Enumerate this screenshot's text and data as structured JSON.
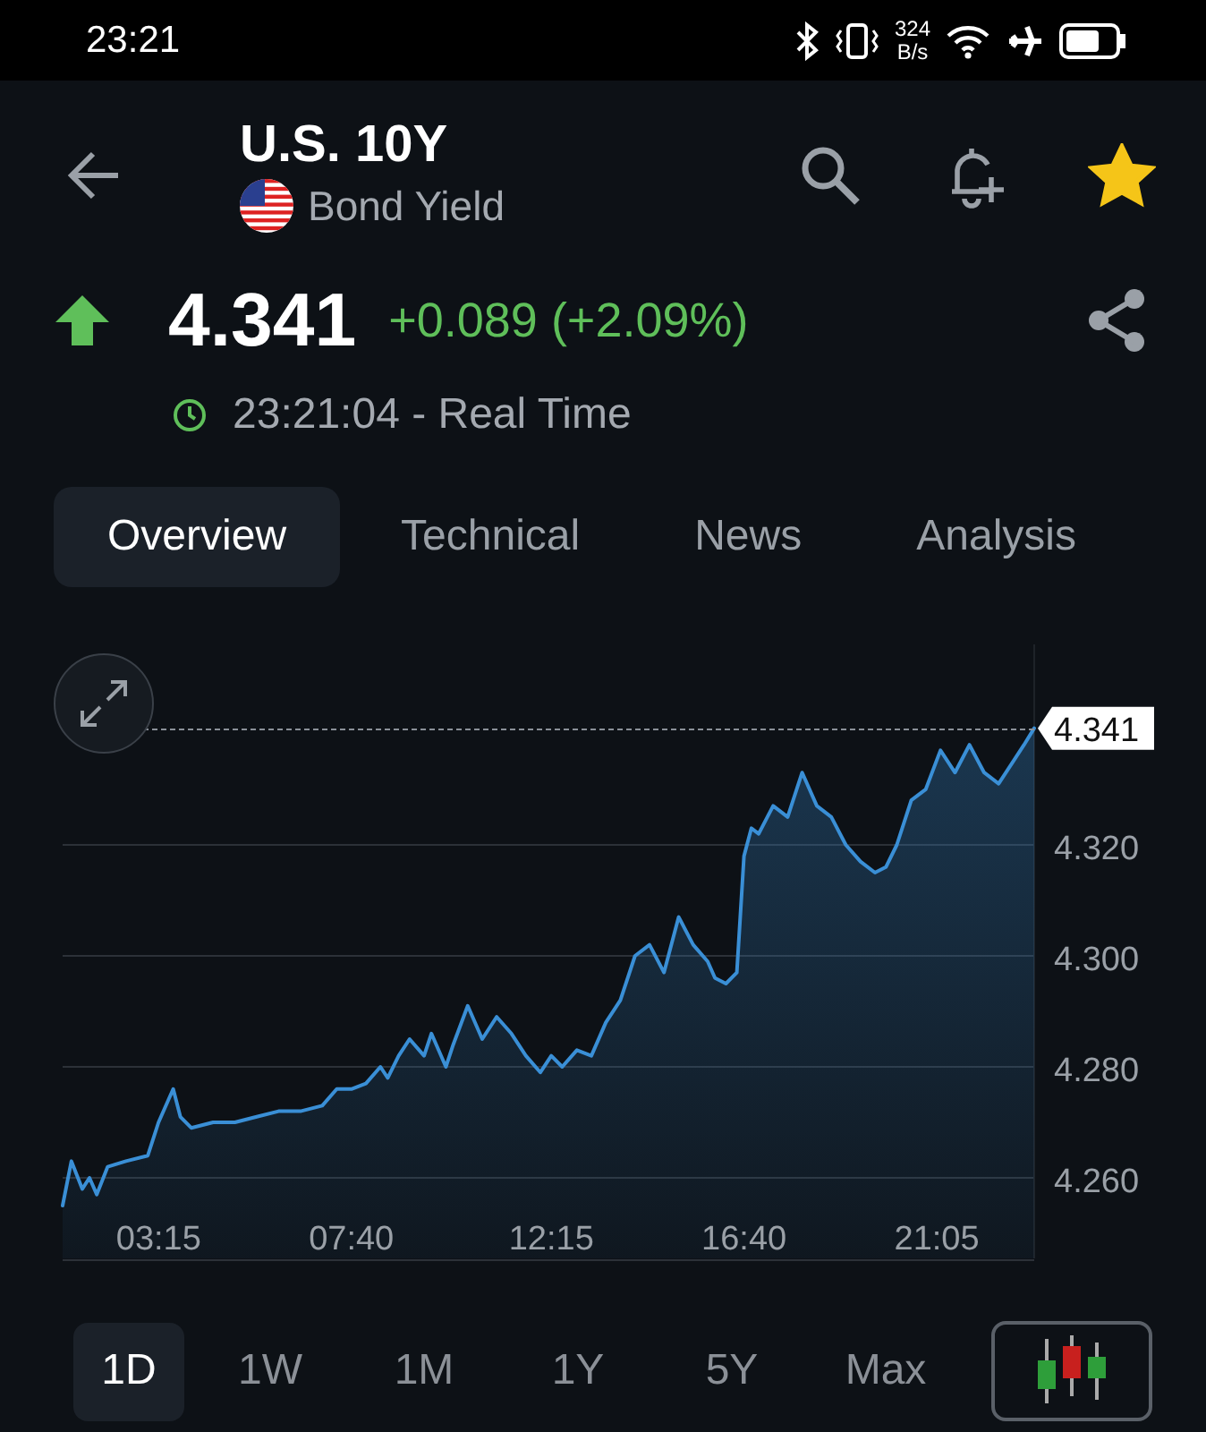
{
  "status_bar": {
    "time": "23:21",
    "speed": "324",
    "speed_unit": "B/s"
  },
  "header": {
    "title": "U.S. 10Y",
    "subtitle": "Bond Yield",
    "starred": true
  },
  "quote": {
    "rising": true,
    "price": "4.341",
    "change": "+0.089 (+2.09%)",
    "time": "23:21:04 - Real Time"
  },
  "tabs": [
    {
      "label": "Overview",
      "selected": true
    },
    {
      "label": "Technical",
      "selected": false
    },
    {
      "label": "News",
      "selected": false
    },
    {
      "label": "Analysis",
      "selected": false
    }
  ],
  "chart": {
    "last_price": "4.341",
    "chart_data": {
      "type": "area",
      "grid": true,
      "x": [
        63,
        75,
        90,
        100,
        110,
        125,
        150,
        180,
        195,
        215,
        225,
        240,
        270,
        300,
        330,
        360,
        390,
        420,
        440,
        460,
        480,
        500,
        510,
        525,
        540,
        560,
        570,
        590,
        600,
        620,
        640,
        660,
        680,
        700,
        720,
        735,
        750,
        770,
        790,
        810,
        830,
        850,
        870,
        890,
        910,
        930,
        950,
        960,
        975,
        990,
        1000,
        1010,
        1020,
        1040,
        1060,
        1080,
        1100,
        1120,
        1140,
        1160,
        1180,
        1195,
        1210,
        1230,
        1250,
        1270,
        1290,
        1310,
        1330,
        1350,
        1370,
        1385,
        1399
      ],
      "series": [
        {
          "color": "#3a8fd6",
          "values": [
            4.255,
            4.263,
            4.258,
            4.26,
            4.257,
            4.262,
            4.263,
            4.264,
            4.27,
            4.276,
            4.271,
            4.269,
            4.27,
            4.27,
            4.271,
            4.272,
            4.272,
            4.273,
            4.276,
            4.276,
            4.277,
            4.28,
            4.278,
            4.282,
            4.285,
            4.282,
            4.286,
            4.28,
            4.284,
            4.291,
            4.285,
            4.289,
            4.286,
            4.282,
            4.279,
            4.282,
            4.28,
            4.283,
            4.282,
            4.288,
            4.292,
            4.3,
            4.302,
            4.297,
            4.307,
            4.302,
            4.299,
            4.296,
            4.295,
            4.297,
            4.318,
            4.323,
            4.322,
            4.327,
            4.325,
            4.333,
            4.327,
            4.325,
            4.32,
            4.317,
            4.315,
            4.316,
            4.32,
            4.328,
            4.33,
            4.337,
            4.333,
            4.338,
            4.333,
            4.331,
            4.335,
            4.338,
            4.341
          ]
        }
      ],
      "xlim": [
        63,
        1399
      ],
      "ylim": [
        4.2455,
        4.3561
      ],
      "xticks": [
        {
          "value": 195,
          "label": "03:15"
        },
        {
          "value": 460,
          "label": "07:40"
        },
        {
          "value": 735,
          "label": "12:15"
        },
        {
          "value": 1000,
          "label": "16:40"
        },
        {
          "value": 1265,
          "label": "21:05"
        }
      ],
      "yticks": [
        {
          "value": 4.26,
          "label": "4.260"
        },
        {
          "value": 4.28,
          "label": "4.280"
        },
        {
          "value": 4.3,
          "label": "4.300"
        },
        {
          "value": 4.32,
          "label": "4.320"
        }
      ]
    }
  },
  "ranges": [
    {
      "label": "1D",
      "selected": true
    },
    {
      "label": "1W",
      "selected": false
    },
    {
      "label": "1M",
      "selected": false
    },
    {
      "label": "1Y",
      "selected": false
    },
    {
      "label": "5Y",
      "selected": false
    },
    {
      "label": "Max",
      "selected": false
    }
  ]
}
